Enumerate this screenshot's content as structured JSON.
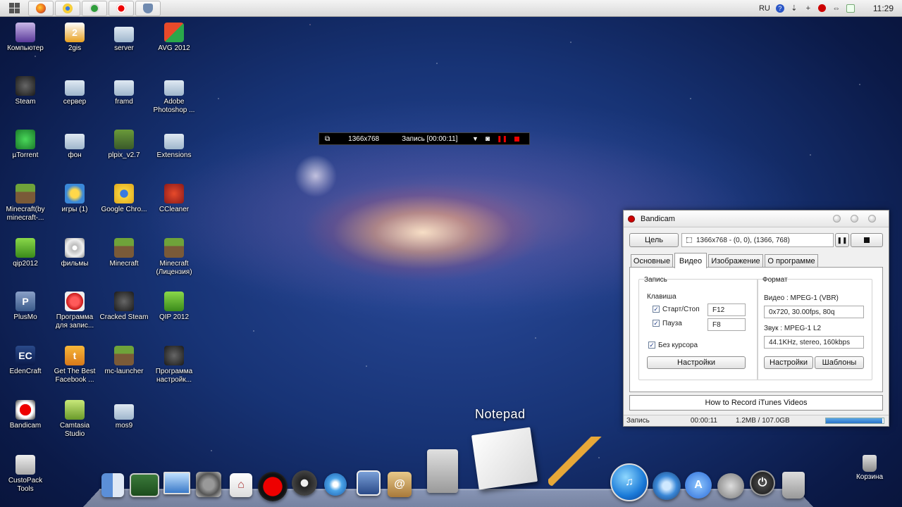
{
  "taskbar": {
    "lang": "RU",
    "clock": "11:29",
    "apps": [
      "firefox-icon",
      "chrome-icon",
      "utorrent-icon",
      "bandicam-icon",
      "vpn-icon"
    ]
  },
  "desktop_icons": [
    {
      "label": "Компьютер",
      "icon": "computer-icon"
    },
    {
      "label": "2gis",
      "icon": "2gis-icon"
    },
    {
      "label": "server",
      "icon": "folder-icon"
    },
    {
      "label": "AVG 2012",
      "icon": "avg-icon"
    },
    {
      "label": "Steam",
      "icon": "steam-icon"
    },
    {
      "label": "сервер",
      "icon": "folder-icon"
    },
    {
      "label": "framd",
      "icon": "folder-icon"
    },
    {
      "label": "Adobe Photoshop ...",
      "icon": "folder-icon"
    },
    {
      "label": "µTorrent",
      "icon": "utorrent-icon"
    },
    {
      "label": "фон",
      "icon": "folder-icon"
    },
    {
      "label": "plpix_v2.7",
      "icon": "pixel-character-icon"
    },
    {
      "label": "Extensions",
      "icon": "folder-icon"
    },
    {
      "label": "Minecraft(by minecraft-...",
      "icon": "minecraft-icon"
    },
    {
      "label": "игры (1)",
      "icon": "games-icon"
    },
    {
      "label": "Google Chro...",
      "icon": "chrome-icon"
    },
    {
      "label": "CCleaner",
      "icon": "ccleaner-icon"
    },
    {
      "label": "qip2012",
      "icon": "qip-icon"
    },
    {
      "label": "фильмы",
      "icon": "disc-icon"
    },
    {
      "label": "Minecraft",
      "icon": "minecraft-icon"
    },
    {
      "label": "Minecraft (Лицензия)",
      "icon": "minecraft-icon"
    },
    {
      "label": "PlusMo",
      "icon": "plusmo-icon"
    },
    {
      "label": "Программа для запис...",
      "icon": "record-icon"
    },
    {
      "label": "Cracked Steam",
      "icon": "steam-icon"
    },
    {
      "label": "QIP 2012",
      "icon": "qip-icon"
    },
    {
      "label": "EdenCraft",
      "icon": "edencraft-icon"
    },
    {
      "label": "Get The Best Facebook ...",
      "icon": "facebook-icon"
    },
    {
      "label": "mc-launcher",
      "icon": "minecraft-icon"
    },
    {
      "label": "Программа настройк...",
      "icon": "steam-icon"
    },
    {
      "label": "Bandicam",
      "icon": "bandicam-icon"
    },
    {
      "label": "Camtasia Studio",
      "icon": "camtasia-icon"
    },
    {
      "label": "mos9",
      "icon": "folder-icon"
    },
    {
      "label": "CustoPack Tools",
      "icon": "custopack-icon"
    }
  ],
  "recbar": {
    "resolution": "1366x768",
    "status": "Запись [00:00:11]"
  },
  "bandicam": {
    "title": "Bandicam",
    "target_button": "Цель",
    "target_field": "1366x768 - (0, 0), (1366, 768)",
    "tabs": [
      "Основные",
      "Видео",
      "Изображение",
      "О программе"
    ],
    "active_tab": "Видео",
    "record_group": "Запись",
    "hotkey_label": "Клавиша",
    "start_stop_label": "Старт/Стоп",
    "start_stop_key": "F12",
    "pause_label": "Пауза",
    "pause_key": "F8",
    "no_cursor_label": "Без курсора",
    "settings_button": "Настройки",
    "format_group": "Формат",
    "video_format": "Видео : MPEG-1 (VBR)",
    "video_params": "0x720, 30.00fps, 80q",
    "audio_format": "Звук : MPEG-1 L2",
    "audio_params": "44.1KHz, stereo, 160kbps",
    "format_settings_button": "Настройки",
    "templates_button": "Шаблоны",
    "link_button": "How to Record iTunes Videos",
    "status_label": "Запись",
    "status_time": "00:00:11",
    "status_size": "1.2MB / 107.0GB",
    "progress": 0.98
  },
  "dock": {
    "hover_label": "Notepad"
  },
  "corner": {
    "trash_label": "Корзина"
  }
}
